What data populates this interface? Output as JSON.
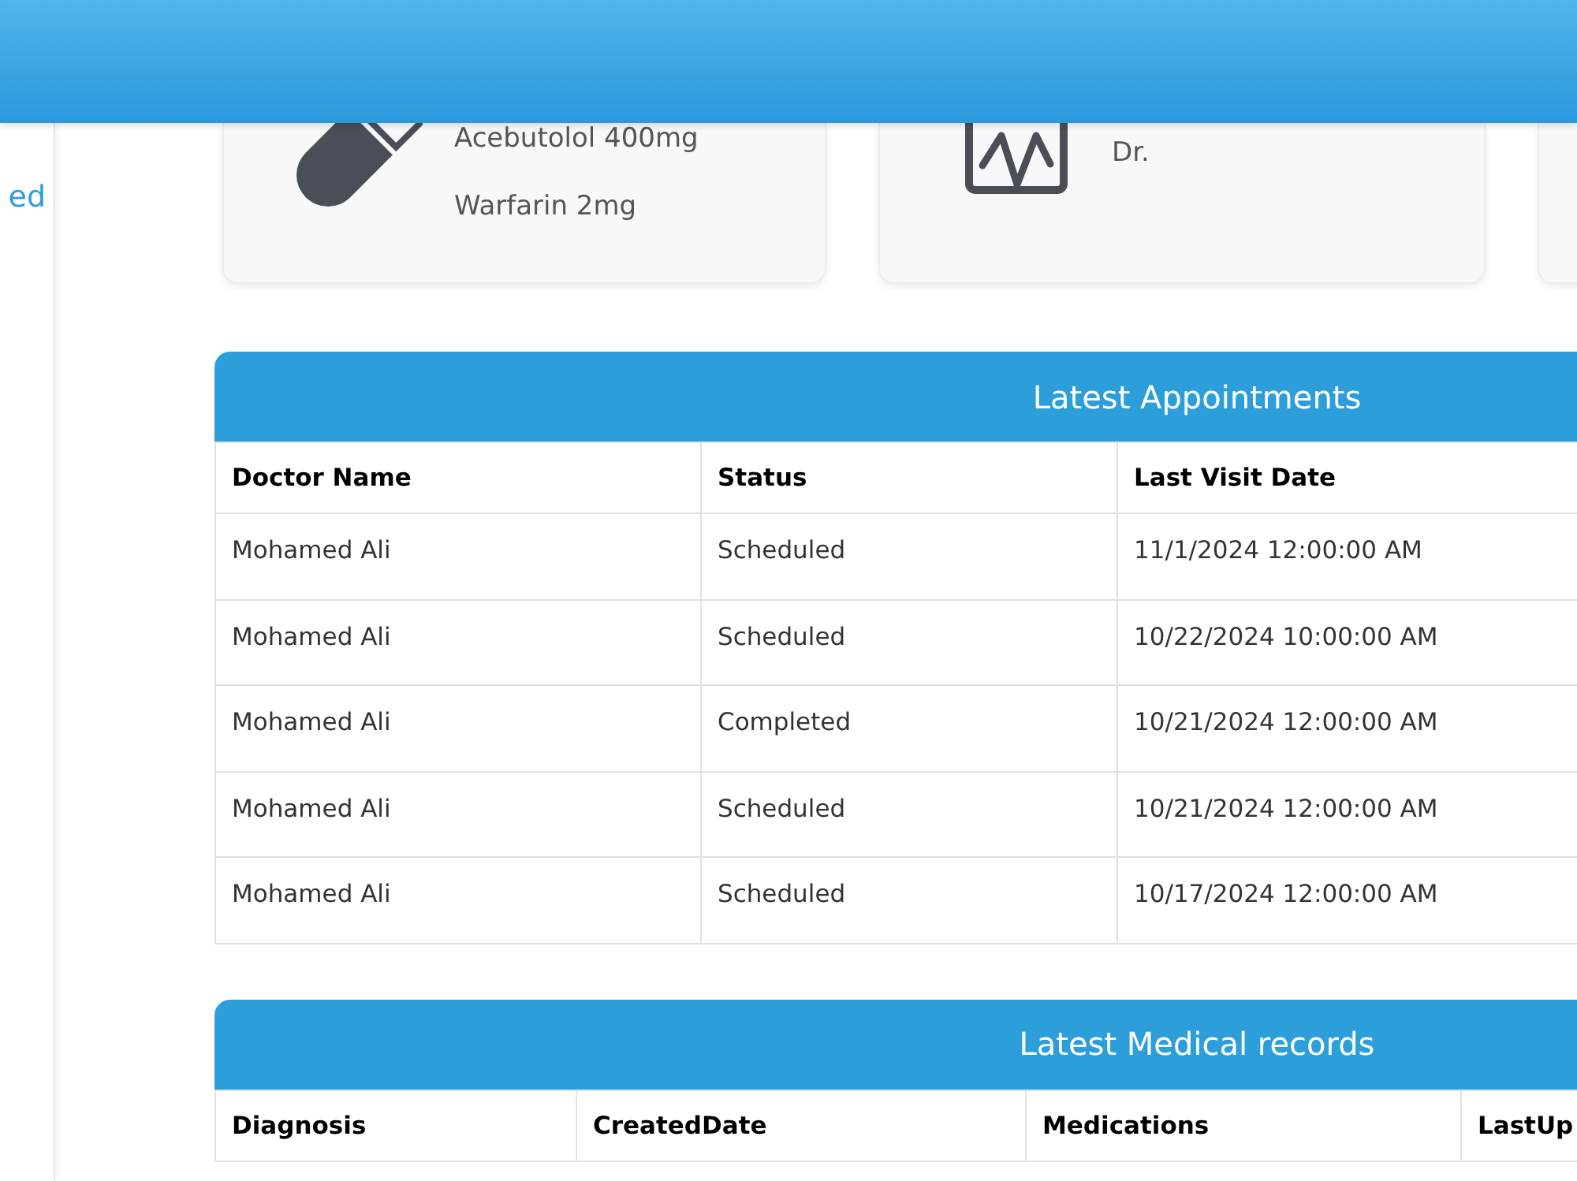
{
  "sidebar": {
    "items": [
      {
        "label": "ed"
      }
    ]
  },
  "cards": [
    {
      "kind": "medications",
      "lines": [
        "Acebutolol 400mg",
        "Warfarin 2mg"
      ]
    },
    {
      "kind": "appointment",
      "lines": [
        "Dr."
      ]
    },
    {
      "kind": "blank"
    }
  ],
  "appointments_table": {
    "title": "Latest Appointments",
    "columns": [
      "Doctor Name",
      "Status",
      "Last Visit Date"
    ],
    "rows": [
      [
        "Mohamed Ali",
        "Scheduled",
        "11/1/2024 12:00:00 AM"
      ],
      [
        "Mohamed Ali",
        "Scheduled",
        "10/22/2024 10:00:00 AM"
      ],
      [
        "Mohamed Ali",
        "Completed",
        "10/21/2024 12:00:00 AM"
      ],
      [
        "Mohamed Ali",
        "Scheduled",
        "10/21/2024 12:00:00 AM"
      ],
      [
        "Mohamed Ali",
        "Scheduled",
        "10/17/2024 12:00:00 AM"
      ]
    ]
  },
  "medical_records_table": {
    "title": "Latest Medical records",
    "columns": [
      "Diagnosis",
      "CreatedDate",
      "Medications",
      "LastUp"
    ]
  }
}
